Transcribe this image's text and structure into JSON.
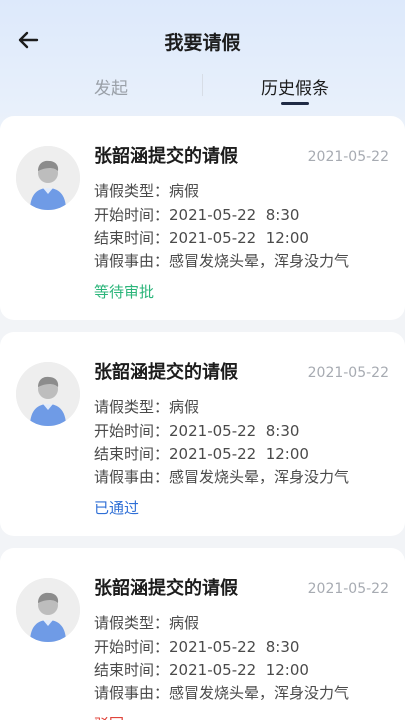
{
  "header": {
    "title": "我要请假",
    "back_icon": "arrow-left-icon"
  },
  "tabs": [
    {
      "label": "发起",
      "active": false
    },
    {
      "label": "历史假条",
      "active": true
    }
  ],
  "labels": {
    "type": "请假类型：",
    "start": "开始时间：",
    "end": "结束时间：",
    "reason": "请假事由："
  },
  "records": [
    {
      "title": "张韶涵提交的请假",
      "date": "2021-05-22",
      "type": "病假",
      "start": "2021-05-22  8:30",
      "end": "2021-05-22  12:00",
      "reason": "感冒发烧头晕，浑身没力气",
      "status": "等待审批",
      "status_color": "#2bb57a"
    },
    {
      "title": "张韶涵提交的请假",
      "date": "2021-05-22",
      "type": "病假",
      "start": "2021-05-22  8:30",
      "end": "2021-05-22  12:00",
      "reason": "感冒发烧头晕，浑身没力气",
      "status": "已通过",
      "status_color": "#2f6fd6"
    },
    {
      "title": "张韶涵提交的请假",
      "date": "2021-05-22",
      "type": "病假",
      "start": "2021-05-22  8:30",
      "end": "2021-05-22  12:00",
      "reason": "感冒发烧头晕，浑身没力气",
      "status": "驳回",
      "status_color": "#e0443b"
    }
  ],
  "colors": {
    "accent": "#1f2a44",
    "avatar_body": "#6f9be6",
    "avatar_head": "#9a9a9a"
  }
}
